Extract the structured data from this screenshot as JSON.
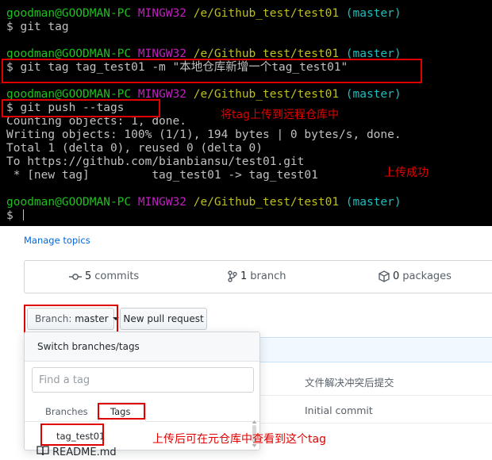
{
  "terminal": {
    "prompt": {
      "user": "goodman@GOODMAN-PC",
      "system": "MINGW32",
      "path": "/e/Github_test/test01",
      "branch": "(master)"
    },
    "commands": {
      "git_tag": "$ git tag",
      "git_tag_create": "$ git tag tag_test01 -m \"本地仓库新增一个tag_test01\"",
      "git_push": "$ git push --tags",
      "empty_prompt": "$ "
    },
    "output": {
      "counting": "Counting objects: 1, done.",
      "writing": "Writing objects: 100% (1/1), 194 bytes | 0 bytes/s, done.",
      "total": "Total 1 (delta 0), reused 0 (delta 0)",
      "to": "To https://github.com/bianbiansu/test01.git",
      "new_tag": " * [new tag]         tag_test01 -> tag_test01"
    },
    "annotations": {
      "push_note": "将tag上传到远程仓库中",
      "success_note": "上传成功"
    }
  },
  "github": {
    "manage_topics": "Manage topics",
    "summary": {
      "commits_count": "5",
      "commits_label": "commits",
      "branch_count": "1",
      "branch_label": "branch",
      "packages_count": "0",
      "packages_label": "packages"
    },
    "branch_button": {
      "prefix": "Branch:",
      "value": "master"
    },
    "new_pull_request": "New pull request",
    "file_rows": {
      "row1_message": "文件解决冲突后提交",
      "row2_message": "Initial commit",
      "readme": "README.md"
    },
    "dropdown": {
      "title": "Switch branches/tags",
      "filter_placeholder": "Find a tag",
      "tabs": [
        "Branches",
        "Tags"
      ],
      "items": [
        "tag_test01"
      ]
    },
    "annotation": "上传后可在元仓库中查看到这个tag"
  },
  "colors": {
    "terminal_bg": "#000000",
    "prompt_user": "#1fbf1f",
    "prompt_system": "#bf1fbf",
    "prompt_path": "#bfbf1f",
    "prompt_branch": "#1fbfbf",
    "annotation_red": "#e00000",
    "link_blue": "#0366d6"
  }
}
